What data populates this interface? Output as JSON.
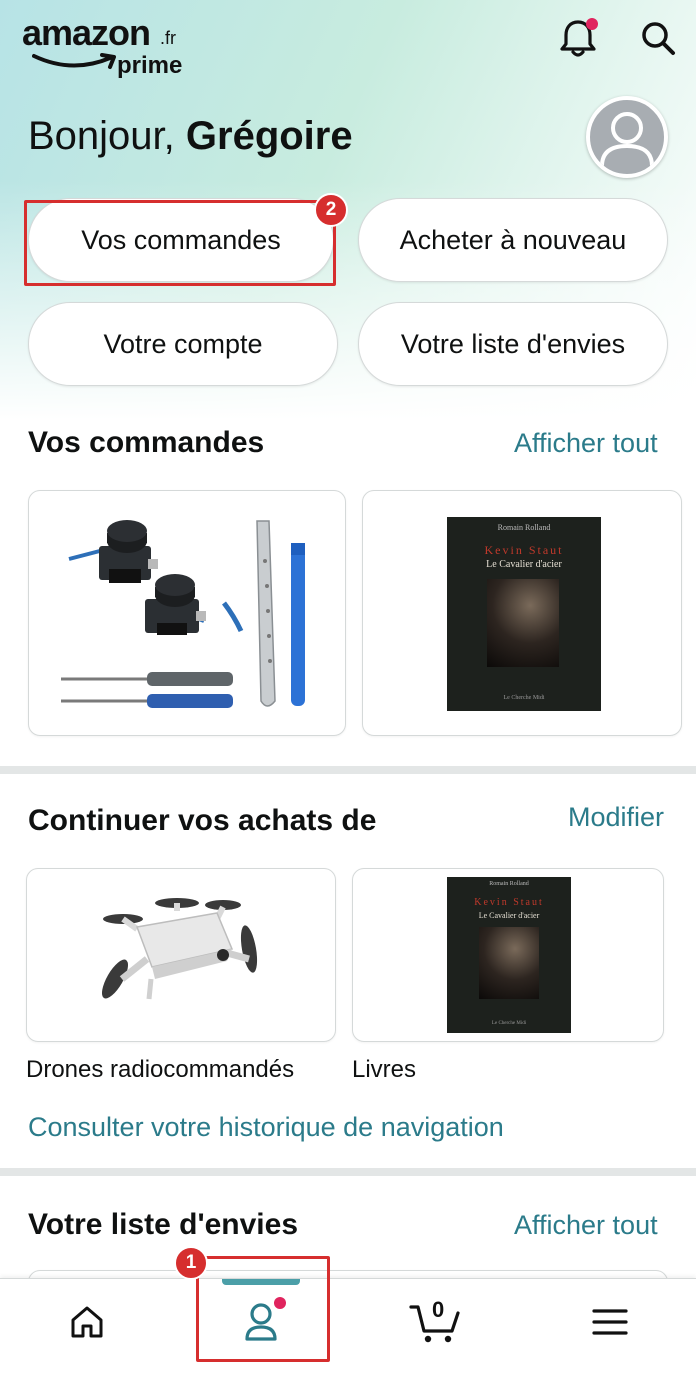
{
  "header": {
    "logo_word": "amazon",
    "logo_tld": ".fr",
    "logo_prime": "prime",
    "icons": [
      "bell-icon",
      "search-icon"
    ]
  },
  "greeting": {
    "prefix": "Bonjour, ",
    "name": "Grégoire"
  },
  "quick_actions": [
    {
      "label": "Vos commandes"
    },
    {
      "label": "Acheter à nouveau"
    },
    {
      "label": "Votre compte"
    },
    {
      "label": "Votre liste d'envies"
    }
  ],
  "annotations": {
    "badge_orders": "2",
    "badge_account_tab": "1",
    "highlight_color": "#d62e2e"
  },
  "orders_section": {
    "title": "Vos commandes",
    "link": "Afficher tout",
    "items": [
      {
        "image": "joystick-repair-kit-image"
      },
      {
        "image": "book-cover-image"
      }
    ]
  },
  "book": {
    "publisher_top": "Romain Rolland",
    "author": "Kevin Staut",
    "title": "Le Cavalier d'acier",
    "publisher_bottom": "Le Cherche Midi"
  },
  "continue_section": {
    "title": "Continuer vos achats de",
    "link": "Modifier",
    "items": [
      {
        "caption": "Drones radiocommandés",
        "image": "drone-image"
      },
      {
        "caption": "Livres",
        "image": "book-cover-image"
      }
    ],
    "history_link": "Consulter votre historique de navigation"
  },
  "wishlist_section": {
    "title": "Votre liste d'envies",
    "link": "Afficher tout"
  },
  "bottom_nav": {
    "items": [
      {
        "icon": "home-icon"
      },
      {
        "icon": "account-icon",
        "active": true
      },
      {
        "icon": "cart-icon",
        "count": "0"
      },
      {
        "icon": "menu-icon"
      }
    ]
  },
  "colors": {
    "accent_link": "#2b7b8a",
    "active_tab_bar": "#4b9fa8",
    "notification_dot": "#e0245e"
  }
}
